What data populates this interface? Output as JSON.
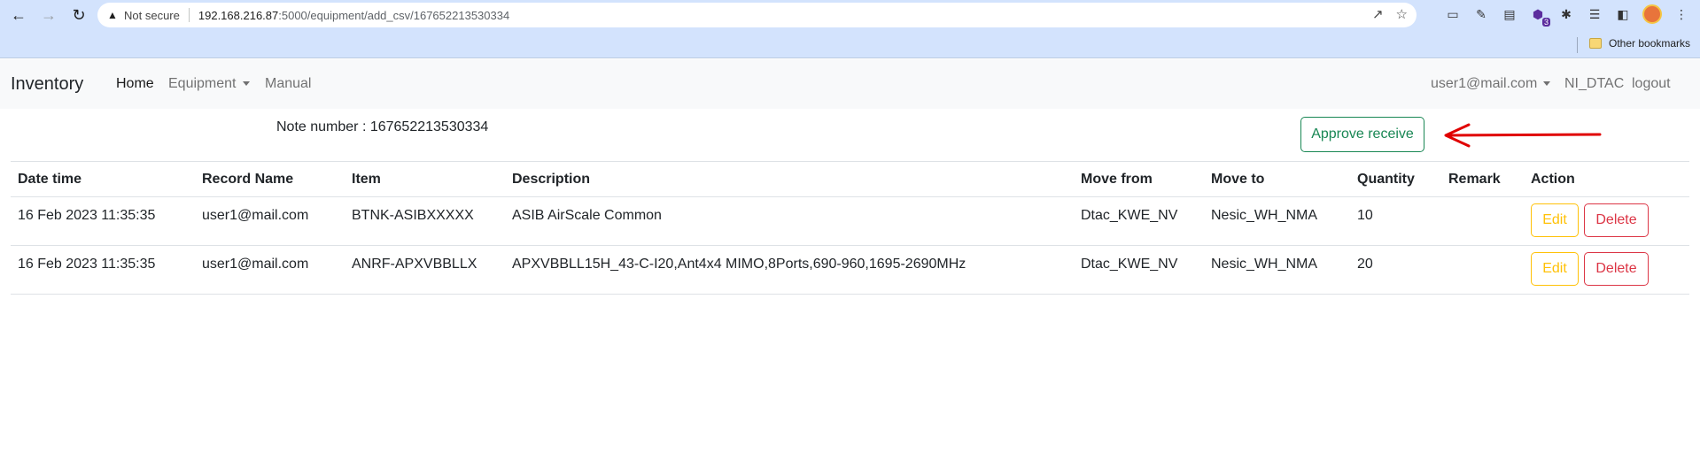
{
  "browser": {
    "security_label": "Not secure",
    "url_host": "192.168.216.87",
    "url_path": ":5000/equipment/add_csv/167652213530334",
    "bookmark_folder": "Other bookmarks",
    "extension_badge": "3"
  },
  "navbar": {
    "brand": "Inventory",
    "home": "Home",
    "equipment": "Equipment",
    "manual": "Manual",
    "user": "user1@mail.com",
    "org": "NI_DTAC",
    "logout": "logout"
  },
  "note": {
    "label": "Note number : 167652213530334"
  },
  "approve_label": "Approve receive",
  "table": {
    "headers": [
      "Date time",
      "Record Name",
      "Item",
      "Description",
      "Move from",
      "Move to",
      "Quantity",
      "Remark",
      "Action"
    ],
    "rows": [
      {
        "datetime": "16 Feb 2023 11:35:35",
        "record": "user1@mail.com",
        "item": "BTNK-ASIBXXXXX",
        "description": "ASIB AirScale Common",
        "move_from": "Dtac_KWE_NV",
        "move_to": "Nesic_WH_NMA",
        "quantity": "10",
        "remark": "",
        "edit": "Edit",
        "delete": "Delete"
      },
      {
        "datetime": "16 Feb 2023 11:35:35",
        "record": "user1@mail.com",
        "item": "ANRF-APXVBBLLX",
        "description": "APXVBBLL15H_43-C-I20,Ant4x4 MIMO,8Ports,690-960,1695-2690MHz",
        "move_from": "Dtac_KWE_NV",
        "move_to": "Nesic_WH_NMA",
        "quantity": "20",
        "remark": "",
        "edit": "Edit",
        "delete": "Delete"
      }
    ]
  },
  "colors": {
    "approve": "#198754",
    "edit": "#ffc107",
    "delete": "#dc3545",
    "annotation_arrow": "#e00000"
  }
}
